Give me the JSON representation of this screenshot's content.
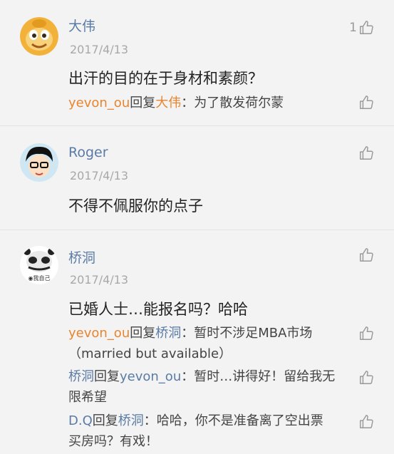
{
  "comments": [
    {
      "username": "大伟",
      "date": "2017/4/13",
      "text": "出汗的目的在于身材和素颜？",
      "like_count": "1",
      "replies": [
        {
          "from": "yevon_ou",
          "verb": "回复",
          "to": "大伟",
          "text": "：为了散发荷尔蒙"
        }
      ]
    },
    {
      "username": "Roger",
      "date": "2017/4/13",
      "text": "不得不佩服你的点子",
      "like_count": "",
      "replies": []
    },
    {
      "username": "桥洞",
      "date": "2017/4/13",
      "text": "已婚人士…能报名吗？哈哈",
      "like_count": "",
      "avatar_caption": "◉我自己",
      "replies": [
        {
          "from": "yevon_ou",
          "verb": "回复",
          "to": "桥洞",
          "text": "：暂时不涉足MBA市场（married  but  available）"
        },
        {
          "from": "桥洞",
          "verb": "回复",
          "to": "yevon_ou",
          "text": "：暂时…讲得好！留给我无限希望"
        },
        {
          "from": "D.Q",
          "verb": "回复",
          "to": "桥洞",
          "text": "：哈哈，你不是准备离了空出票买房吗？有戏！"
        }
      ]
    }
  ],
  "colors": {
    "username": "#5a7ba6",
    "reply_author_orange": "#e8852e",
    "date": "#a8a8a8",
    "background": "#f3f3f3"
  },
  "icons": {
    "like": "thumbs-up-icon"
  }
}
